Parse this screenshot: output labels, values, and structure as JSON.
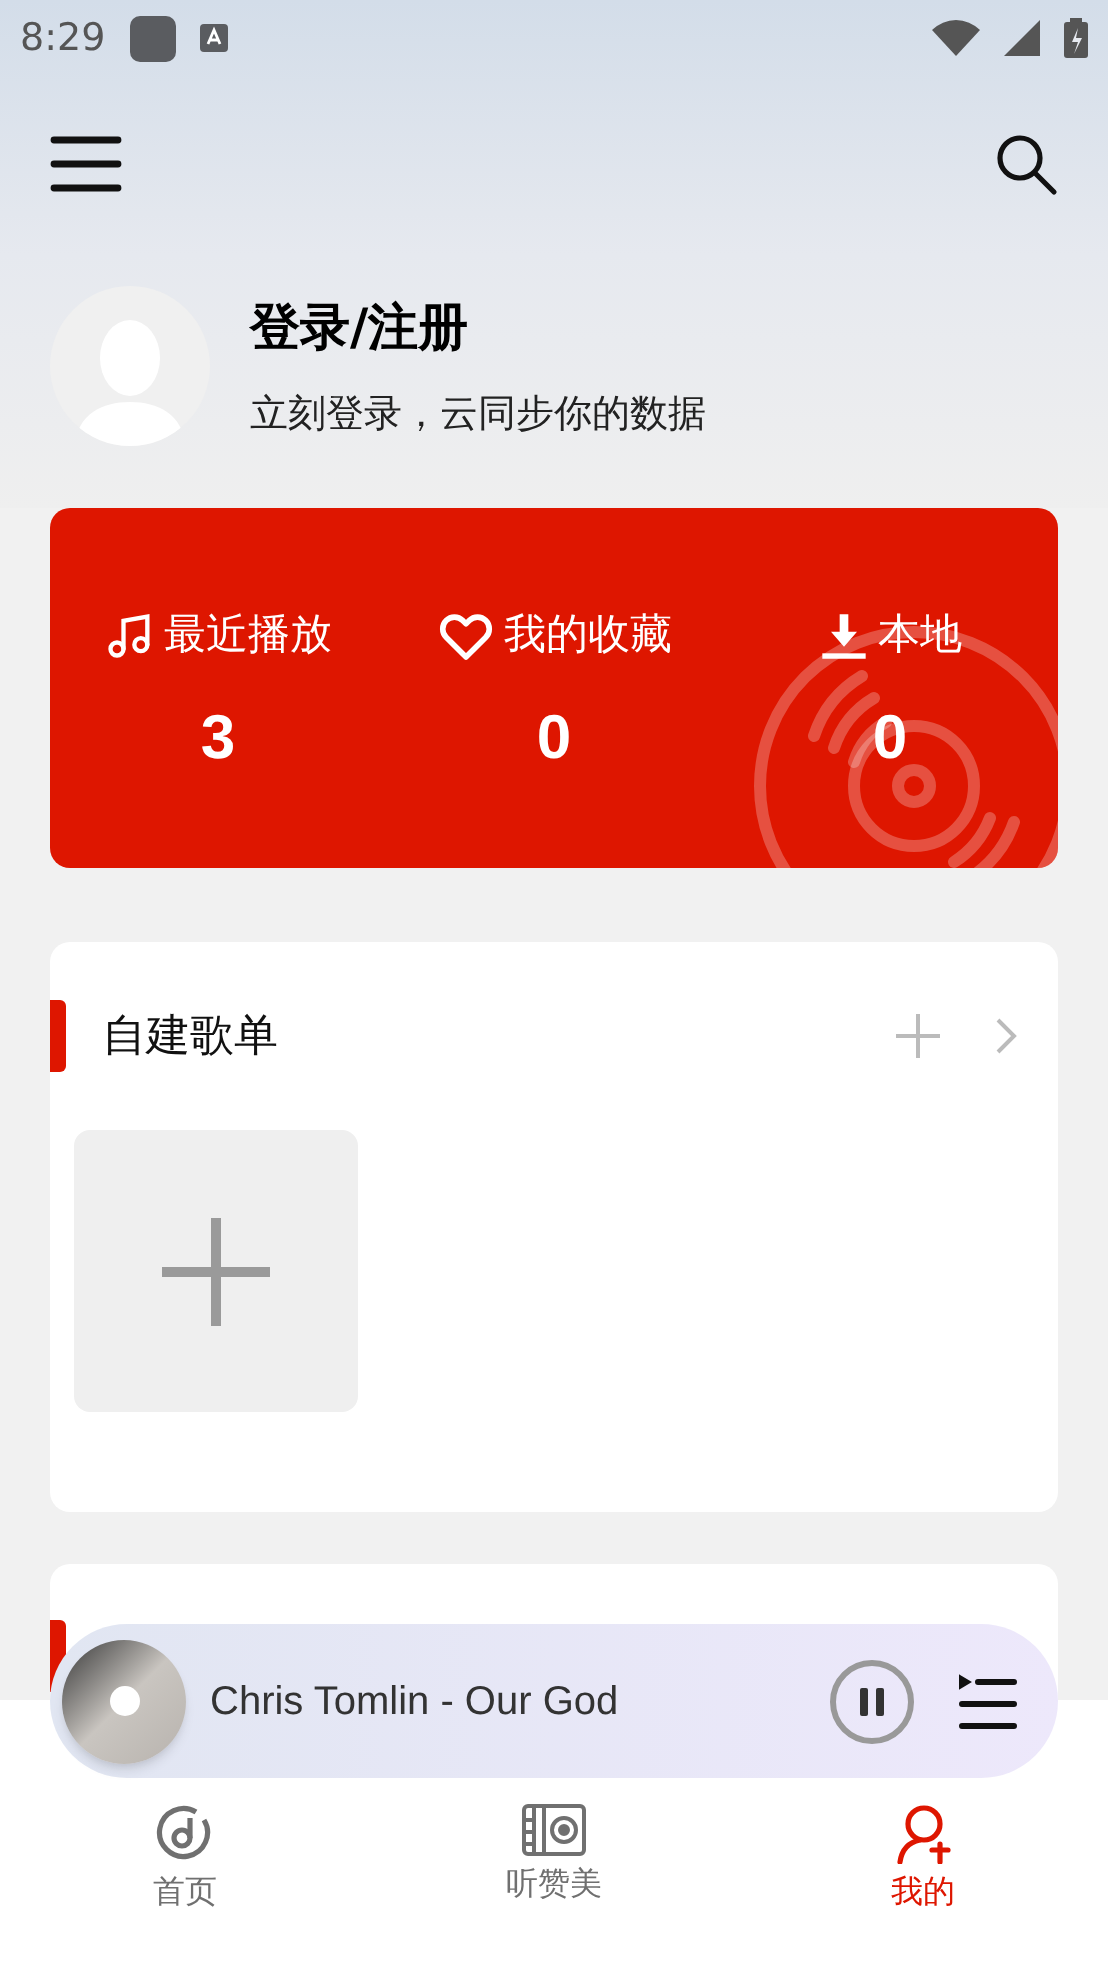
{
  "status_bar": {
    "time": "8:29"
  },
  "profile": {
    "title": "登录/注册",
    "subtitle": "立刻登录，云同步你的数据"
  },
  "stats": [
    {
      "kind": "recent",
      "label": "最近播放",
      "count": "3"
    },
    {
      "kind": "favorite",
      "label": "我的收藏",
      "count": "0"
    },
    {
      "kind": "local",
      "label": "本地",
      "count": "0"
    }
  ],
  "playlist_section": {
    "title": "自建歌单"
  },
  "now_playing": {
    "title": "Chris Tomlin - Our God",
    "playing": true
  },
  "tabs": [
    {
      "kind": "home",
      "label": "首页",
      "selected": false
    },
    {
      "kind": "listen",
      "label": "听赞美",
      "selected": false
    },
    {
      "kind": "mine",
      "label": "我的",
      "selected": true
    }
  ]
}
